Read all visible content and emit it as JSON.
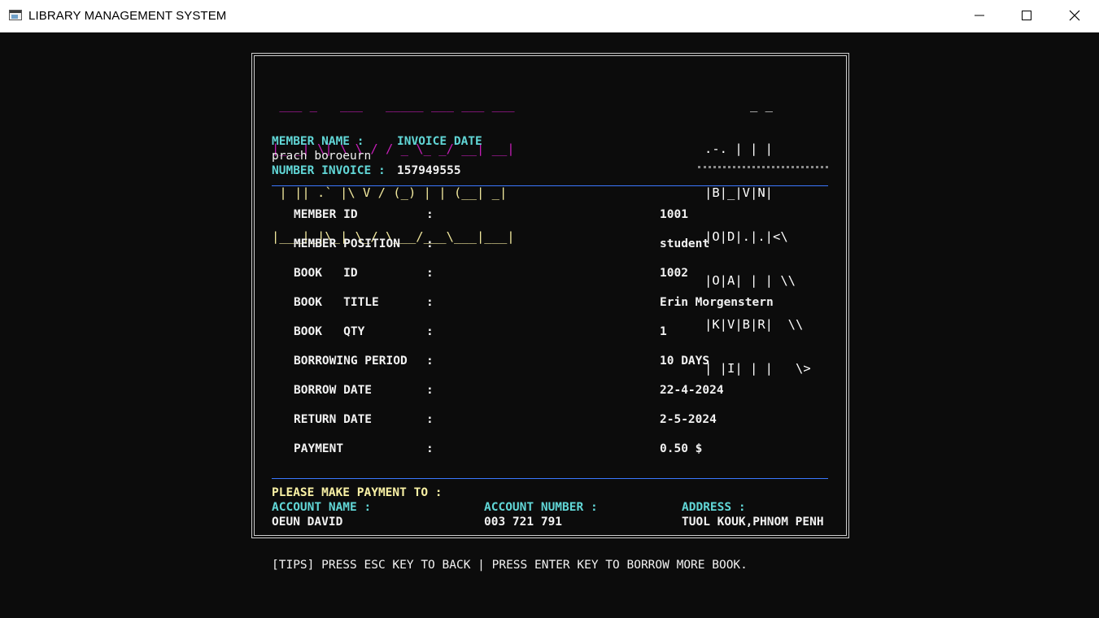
{
  "window": {
    "title": "LIBRARY MANAGEMENT SYSTEM",
    "controls": [
      "minimize",
      "maximize",
      "close"
    ]
  },
  "banner": {
    "invoice_art": [
      " ___ _   ___   _____ ___ ___ ___ ",
      "|_ _| \\| \\ \\ / / _ \\_ _/ __| __|",
      " | || .` |\\ V / (_) | | (__| _| ",
      "|___|_|\\_| \\_/ \\___/___\\___|___|"
    ],
    "logo_art": [
      "      _ _",
      ".-. | | |",
      "|B|_|V|N|",
      "|O|D|.|.|<\\",
      "|O|A| | | \\\\",
      "|K|V|B|R|  \\\\",
      "| |I| | |   \\>"
    ]
  },
  "header": {
    "member_name_label": "MEMBER NAME :",
    "invoice_date_label": "INVOICE DATE",
    "member_name_value": "prach boroeurn",
    "number_invoice_label": "NUMBER INVOICE :",
    "number_invoice_value": "157949555"
  },
  "details": [
    {
      "label": "MEMBER ID",
      "colon": ":",
      "value": "1001"
    },
    {
      "label": "MEMBER POSITION",
      "colon": ":",
      "value": "student"
    },
    {
      "label": "BOOK   ID",
      "colon": ":",
      "value": "1002"
    },
    {
      "label": "BOOK   TITLE",
      "colon": ":",
      "value": "Erin Morgenstern"
    },
    {
      "label": "BOOK   QTY",
      "colon": ":",
      "value": "1"
    },
    {
      "label": "BORROWING PERIOD",
      "colon": ":",
      "value": "10 DAYS"
    },
    {
      "label": "BORROW DATE",
      "colon": ":",
      "value": "22-4-2024"
    },
    {
      "label": "RETURN DATE",
      "colon": ":",
      "value": "2-5-2024"
    },
    {
      "label": "PAYMENT",
      "colon": ":",
      "value": "0.50 $"
    }
  ],
  "payment": {
    "heading": "PLEASE MAKE PAYMENT TO :",
    "account_name_label": "ACCOUNT NAME :",
    "account_name_value": "OEUN DAVID",
    "account_number_label": "ACCOUNT NUMBER :",
    "account_number_value": "003 721 791",
    "address_label": "ADDRESS :",
    "address_value": "TUOL KOUK,PHNOM PENH"
  },
  "tips": "[TIPS] PRESS ESC KEY TO BACK | PRESS ENTER KEY TO BORROW MORE BOOK.",
  "colors": {
    "background": "#0c0c0c",
    "cyan": "#61d6d6",
    "yellow": "#f9f1a5",
    "magenta": "#c41eb6",
    "separator": "#3b78ff"
  }
}
